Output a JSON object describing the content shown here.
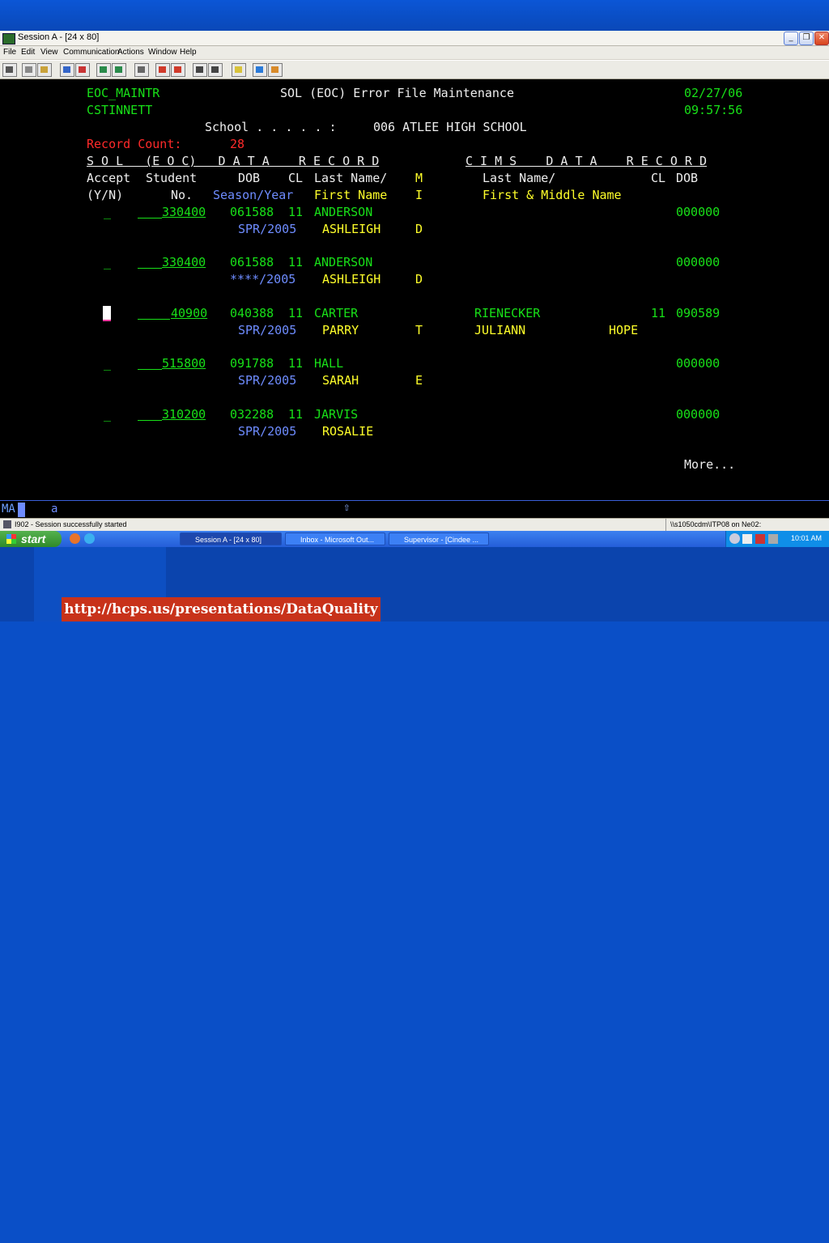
{
  "window": {
    "title": "Session A - [24 x 80]",
    "menu": [
      "File",
      "Edit",
      "View",
      "Communication",
      "Actions",
      "Window",
      "Help"
    ]
  },
  "screen": {
    "program": "EOC_MAINTR",
    "heading": "SOL (EOC) Error File Maintenance",
    "date": "02/27/06",
    "user": "CSTINNETT",
    "time": "09:57:56",
    "school_label": "School . . . . . :",
    "school_value": "006 ATLEE HIGH SCHOOL",
    "record_count_label": "Record Count:",
    "record_count": "28",
    "sol_header": "S O L   (E O C)   D A T A    R E C O R D",
    "cims_header": "C I M S    D A T A    R E C O R D",
    "col_accept": "Accept",
    "col_student": "Student",
    "col_dob": "DOB",
    "col_cl": "CL",
    "col_lastname": "Last Name/",
    "col_m": "M",
    "col_yn": "(Y/N)",
    "col_no": "No.",
    "col_season": "Season/Year",
    "col_firstname": "First Name",
    "col_i": "I",
    "cims_lastname": "Last Name/",
    "cims_firstmiddle": "First & Middle Name",
    "cims_cl": "CL",
    "cims_dob": "DOB",
    "more": "More...",
    "records": [
      {
        "accept": "_",
        "student_no": "330400",
        "dob": "061588",
        "cl": "11",
        "last": "ANDERSON",
        "season": "SPR/2005",
        "first": "ASHLEIGH",
        "mi": "D",
        "cims_last": "",
        "cims_first": "",
        "cims_middle": "",
        "cims_cl": "",
        "cims_dob": "000000"
      },
      {
        "accept": "_",
        "student_no": "330400",
        "dob": "061588",
        "cl": "11",
        "last": "ANDERSON",
        "season": "****/2005",
        "first": "ASHLEIGH",
        "mi": "D",
        "cims_last": "",
        "cims_first": "",
        "cims_middle": "",
        "cims_cl": "",
        "cims_dob": "000000"
      },
      {
        "accept": "",
        "student_no": "40900",
        "dob": "040388",
        "cl": "11",
        "last": "CARTER",
        "season": "SPR/2005",
        "first": "PARRY",
        "mi": "T",
        "cims_last": "RIENECKER",
        "cims_first": "JULIANN",
        "cims_middle": "HOPE",
        "cims_cl": "11",
        "cims_dob": "090589"
      },
      {
        "accept": "_",
        "student_no": "515800",
        "dob": "091788",
        "cl": "11",
        "last": "HALL",
        "season": "SPR/2005",
        "first": "SARAH",
        "mi": "E",
        "cims_last": "",
        "cims_first": "",
        "cims_middle": "",
        "cims_cl": "",
        "cims_dob": "000000"
      },
      {
        "accept": "_",
        "student_no": "310200",
        "dob": "032288",
        "cl": "11",
        "last": "JARVIS",
        "season": "SPR/2005",
        "first": "ROSALIE",
        "mi": "",
        "cims_last": "",
        "cims_first": "",
        "cims_middle": "",
        "cims_cl": "",
        "cims_dob": "000000"
      }
    ]
  },
  "oia": {
    "mode": "MA",
    "indicator": "a",
    "arrow": "⇧"
  },
  "status": {
    "message": "I902 - Session successfully started",
    "host": "\\\\s1050cdm\\ITP08 on Ne02:"
  },
  "taskbar": {
    "start": "start",
    "tasks": [
      "Session A - [24 x 80]",
      "Inbox - Microsoft Out...",
      "Supervisor - [Cindee ..."
    ],
    "clock": "10:01 AM"
  },
  "footer_url": "http://hcps.us/presentations/DataQuality"
}
